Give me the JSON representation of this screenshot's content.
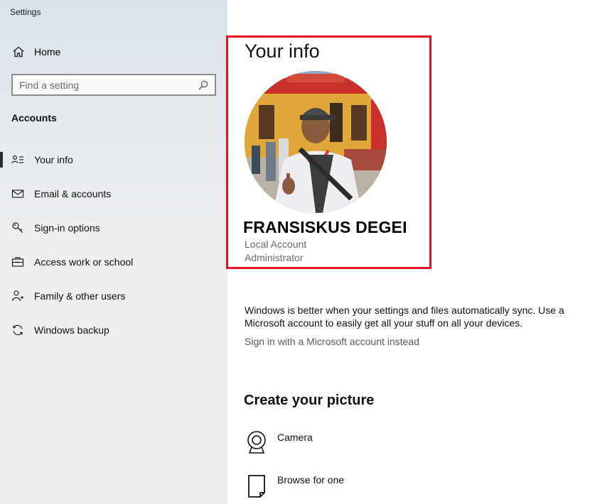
{
  "window": {
    "title": "Settings"
  },
  "sidebar": {
    "home": {
      "label": "Home",
      "icon": "home-icon"
    },
    "search": {
      "placeholder": "Find a setting",
      "value": "",
      "icon": "search-icon"
    },
    "section_heading": "Accounts",
    "items": [
      {
        "label": "Your info",
        "icon": "person-card-icon",
        "active": true
      },
      {
        "label": "Email & accounts",
        "icon": "mail-icon",
        "active": false
      },
      {
        "label": "Sign-in options",
        "icon": "key-icon",
        "active": false
      },
      {
        "label": "Access work or school",
        "icon": "briefcase-icon",
        "active": false
      },
      {
        "label": "Family & other users",
        "icon": "person-add-icon",
        "active": false
      },
      {
        "label": "Windows backup",
        "icon": "sync-icon",
        "active": false
      }
    ]
  },
  "main": {
    "title": "Your info",
    "user": {
      "name": "FRANSISKUS DEGEI",
      "account_type": "Local Account",
      "role": "Administrator"
    },
    "sync_message": "Windows is better when your settings and files automatically sync. Use a Microsoft account to easily get all your stuff on all your devices.",
    "sign_in_link": "Sign in with a Microsoft account instead",
    "create_picture": {
      "heading": "Create your picture",
      "options": [
        {
          "label": "Camera",
          "icon": "camera-icon"
        },
        {
          "label": "Browse for one",
          "icon": "browse-file-icon"
        }
      ]
    }
  },
  "colors": {
    "highlight_border": "#e81123",
    "sidebar_background": "#eceef0",
    "link_text": "#5a5a5a"
  }
}
